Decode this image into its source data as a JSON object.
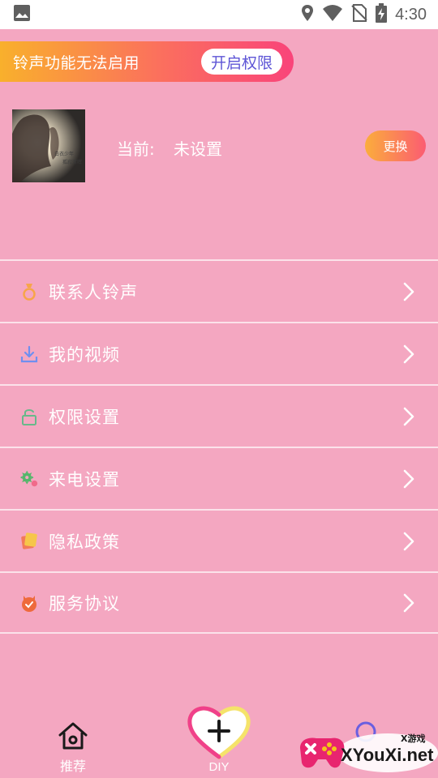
{
  "status_bar": {
    "time": "4:30",
    "icons": [
      "image-icon",
      "location-icon",
      "wifi-icon",
      "no-sim-icon",
      "battery-charging-icon"
    ]
  },
  "banner": {
    "text": "铃声功能无法启用",
    "button_label": "开启权限"
  },
  "current": {
    "label": "当前:",
    "value": "未设置",
    "change_label": "更换",
    "cover_text_line1": "白衣少年",
    "cover_text_line2": "孤寂清晖"
  },
  "menu": {
    "items": [
      {
        "label": "联系人铃声",
        "icon": "ring-icon",
        "icon_color": "#f7a54a"
      },
      {
        "label": "我的视频",
        "icon": "download-icon",
        "icon_color": "#6f8ff0"
      },
      {
        "label": "权限设置",
        "icon": "lock-icon",
        "icon_color": "#67b98a"
      },
      {
        "label": "来电设置",
        "icon": "gear-icon",
        "icon_color": "#55b66b"
      },
      {
        "label": "隐私政策",
        "icon": "card-icon",
        "icon_color": "#f6c64a"
      },
      {
        "label": "服务协议",
        "icon": "agreement-icon",
        "icon_color": "#ee6a3c"
      }
    ]
  },
  "bottom_nav": {
    "home_label": "推荐",
    "diy_label": "DIY"
  },
  "watermark": {
    "text": "XYouXi.net",
    "sub": "X游戏"
  },
  "colors": {
    "background": "#f4a7c1",
    "accent_purple": "#5e55d6",
    "divider": "#fbe2ea"
  }
}
